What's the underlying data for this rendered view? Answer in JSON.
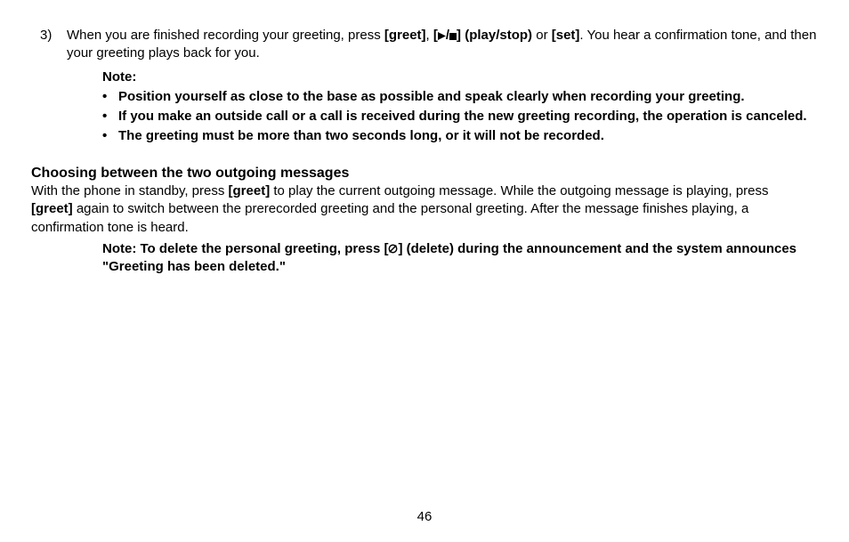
{
  "step": {
    "number": "3)",
    "text_before": "When you are finished recording your greeting, press ",
    "btn_greet": "[greet]",
    "sep1": ", ",
    "bracket_open": "[",
    "bracket_close": "]",
    "playstop_label": " (play/stop)",
    "sep2": " or ",
    "btn_set": "[set]",
    "text_after": ". You hear a confirmation tone, and then your greeting plays back for you."
  },
  "note_heading": "Note:",
  "notes": {
    "n1": "Position yourself as close to the base as possible and speak clearly when recording your greeting.",
    "n2": "If you make an outside call or a call is received during the new greeting recording, the operation is canceled.",
    "n3": "The greeting must be more than two seconds long, or it will not be recorded."
  },
  "section_heading": "Choosing between the two outgoing messages",
  "section_para": {
    "t1": "With the phone in standby, press ",
    "b1": "[greet]",
    "t2": " to play the current outgoing message. While the outgoing message is playing, press ",
    "b2": "[greet]",
    "t3": " again to switch between the prerecorded greeting and the personal greeting. After the message finishes playing, a confirmation tone is heard."
  },
  "delete_note": {
    "t1": "Note: To delete the personal greeting, press [",
    "t2": "] (delete) during the announcement and the system announces \"Greeting has been deleted.\""
  },
  "page_number": "46"
}
